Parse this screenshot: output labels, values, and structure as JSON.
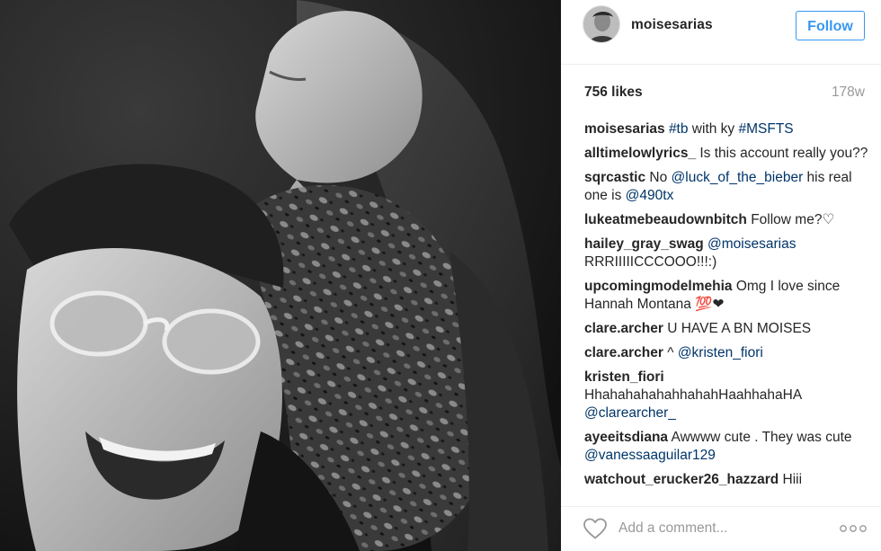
{
  "post": {
    "username": "moisesarias",
    "follow_label": "Follow",
    "likes": "756 likes",
    "time_ago": "178w"
  },
  "comments": [
    {
      "user": "moisesarias",
      "parts": [
        {
          "t": "tag",
          "v": "#tb"
        },
        {
          "t": "text",
          "v": " with ky "
        },
        {
          "t": "tag",
          "v": "#MSFTS"
        }
      ]
    },
    {
      "user": "alltimelowlyrics_",
      "parts": [
        {
          "t": "text",
          "v": "Is this account really you??"
        }
      ]
    },
    {
      "user": "sqrcastic",
      "parts": [
        {
          "t": "text",
          "v": "No "
        },
        {
          "t": "mention",
          "v": "@luck_of_the_bieber"
        },
        {
          "t": "text",
          "v": " his real one is "
        },
        {
          "t": "mention",
          "v": "@490tx"
        }
      ]
    },
    {
      "user": "lukeatmebeaudownbitch",
      "parts": [
        {
          "t": "text",
          "v": "Follow me?♡"
        }
      ]
    },
    {
      "user": "hailey_gray_swag",
      "parts": [
        {
          "t": "mention",
          "v": "@moisesarias"
        },
        {
          "t": "text",
          "v": " RRRIIIIICCCOOO!!!:)"
        }
      ]
    },
    {
      "user": "upcomingmodelmehia",
      "parts": [
        {
          "t": "text",
          "v": "Omg I love since Hannah Montana 💯❤"
        }
      ]
    },
    {
      "user": "clare.archer",
      "parts": [
        {
          "t": "text",
          "v": "U HAVE A BN MOISES"
        }
      ]
    },
    {
      "user": "clare.archer",
      "parts": [
        {
          "t": "text",
          "v": "^ "
        },
        {
          "t": "mention",
          "v": "@kristen_fiori"
        }
      ]
    },
    {
      "user": "kristen_fiori",
      "parts": [
        {
          "t": "text",
          "v": "HhahahahahahhahahHaahhahaHA "
        },
        {
          "t": "mention",
          "v": "@clarearcher_"
        }
      ]
    },
    {
      "user": "ayeeitsdiana",
      "parts": [
        {
          "t": "text",
          "v": "Awwww cute . They was cute "
        },
        {
          "t": "mention",
          "v": "@vanessaaguilar129"
        }
      ]
    },
    {
      "user": "watchout_erucker26_hazzard",
      "parts": [
        {
          "t": "text",
          "v": "Hiii"
        }
      ]
    }
  ],
  "footer": {
    "comment_placeholder": "Add a comment..."
  },
  "icons": {
    "like": "heart-outline-icon",
    "more": "more-options-icon"
  },
  "colors": {
    "accent": "#3897f0",
    "link": "#003569",
    "muted": "#999999",
    "text": "#262626"
  }
}
